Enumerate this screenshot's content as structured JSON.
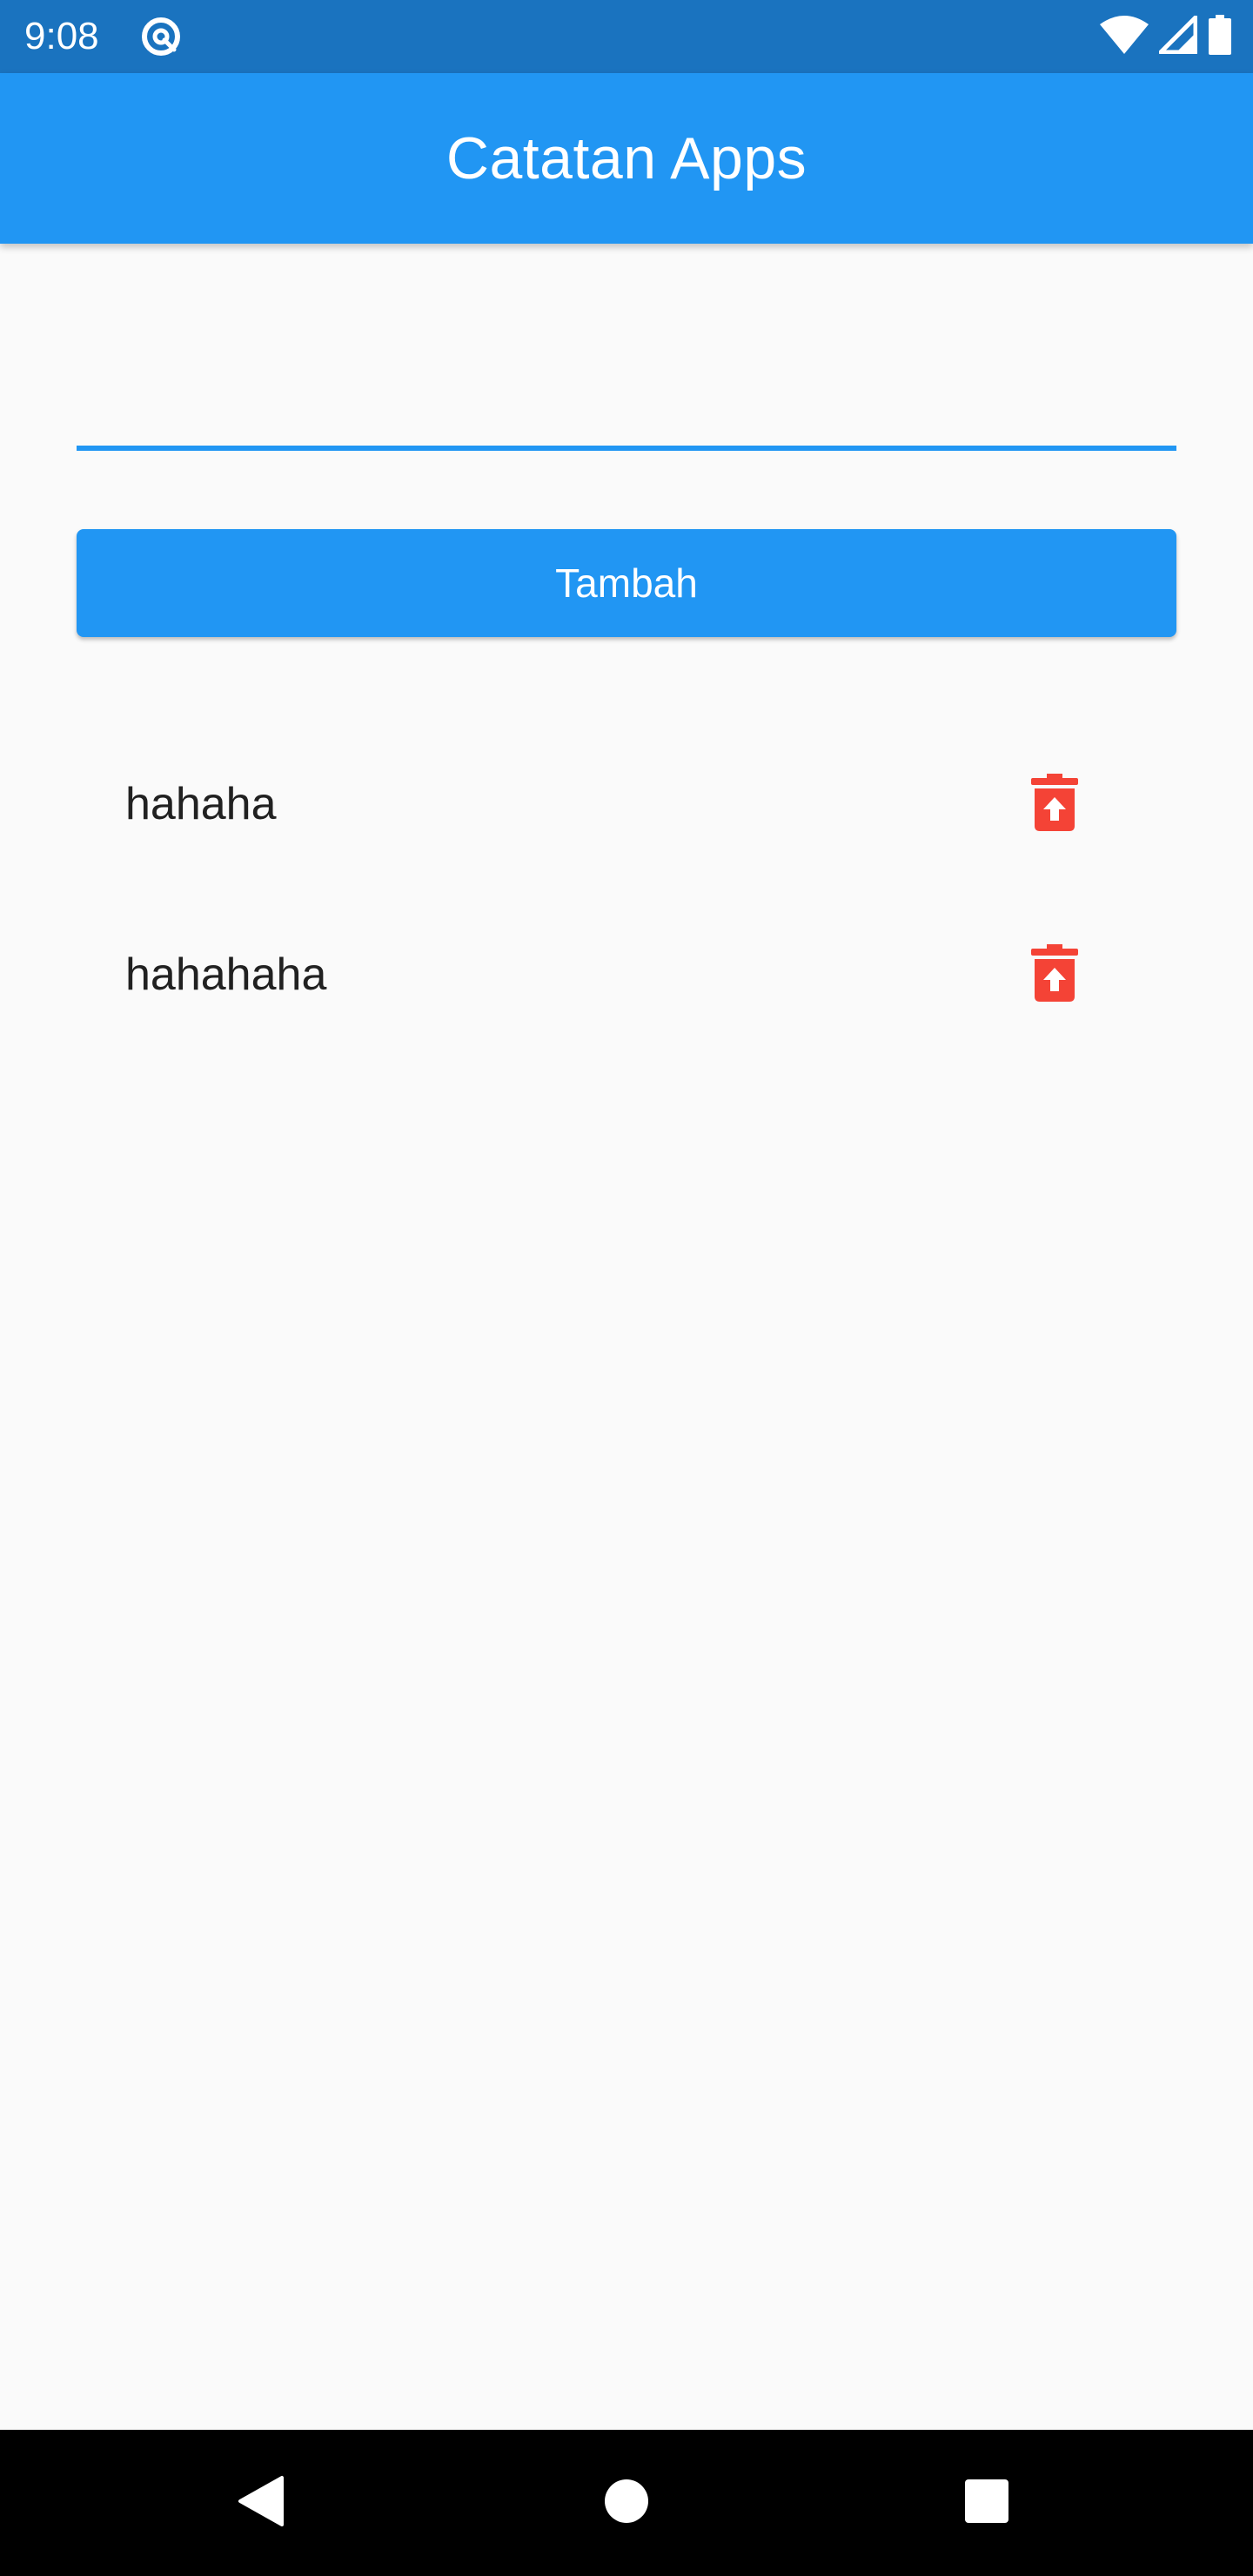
{
  "status_bar": {
    "time": "9:08",
    "app_icon": "at-sign-icon",
    "icons": [
      "wifi-icon",
      "cellular-signal-icon",
      "battery-icon"
    ]
  },
  "app_bar": {
    "title": "Catatan Apps",
    "color": "#2196f3"
  },
  "input": {
    "value": "",
    "placeholder": "",
    "underline_color": "#2196f3"
  },
  "add_button": {
    "label": "Tambah",
    "color": "#2196f3"
  },
  "notes": [
    {
      "text": "hahaha",
      "delete_icon": "trash-icon"
    },
    {
      "text": "hahahaha",
      "delete_icon": "trash-icon"
    }
  ],
  "delete_icon_color": "#f44336",
  "nav_bar": {
    "buttons": [
      "back-icon",
      "home-icon",
      "recents-icon"
    ]
  }
}
